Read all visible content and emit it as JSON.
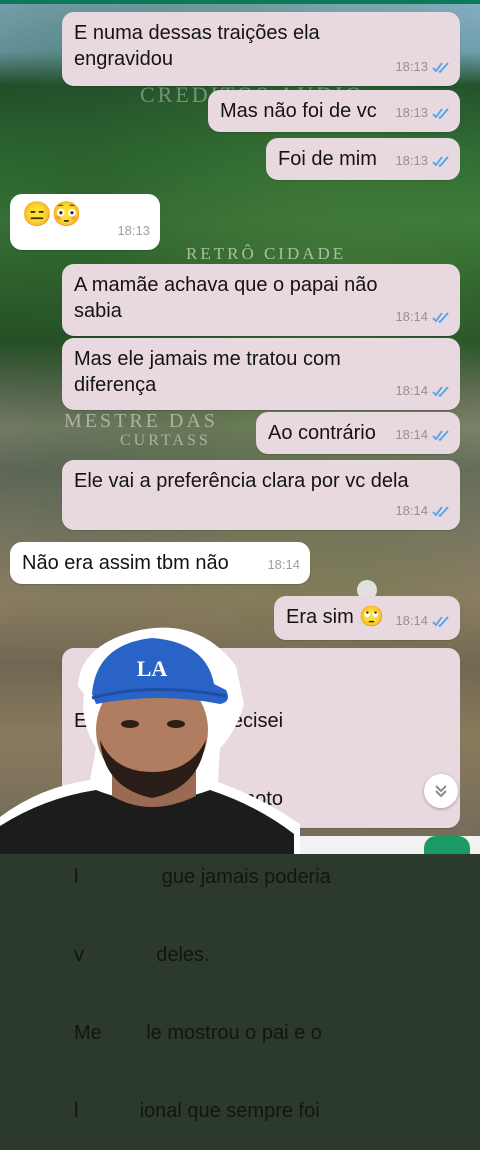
{
  "watermarks": [
    "CREDITOS AUDIO",
    "RETRÔ CIDADE",
    "MESTRE DAS",
    "CURTASS"
  ],
  "messages": [
    {
      "dir": "out",
      "text": "E numa dessas traições ela engravidou",
      "time": "18:13",
      "status": "read"
    },
    {
      "dir": "out",
      "text": "Mas não foi de vc",
      "time": "18:13",
      "status": "read"
    },
    {
      "dir": "out",
      "text": "Foi de mim",
      "time": "18:13",
      "status": "read"
    },
    {
      "dir": "in",
      "text": "😑😳",
      "time": "18:13"
    },
    {
      "dir": "out",
      "text": "A mamãe achava que o papai não sabia",
      "time": "18:14",
      "status": "read"
    },
    {
      "dir": "out",
      "text": "Mas ele jamais me tratou com diferença",
      "time": "18:14",
      "status": "read"
    },
    {
      "dir": "out",
      "text": "Ao contrário",
      "time": "18:14",
      "status": "read"
    },
    {
      "dir": "out",
      "text": "Ele vai a preferência clara por vc dela",
      "time": "18:14",
      "status": "read"
    },
    {
      "dir": "in",
      "text": "Não era assim tbm não",
      "time": "18:14"
    },
    {
      "dir": "out",
      "text": "Era sim 🙄",
      "time": "18:14",
      "status": "read"
    },
    {
      "dir": "out",
      "lines": [
        "El      uando eu precisei",
        "d              o cai de moto",
        "l               gue jamais poderia",
        "v             deles.",
        "Me        le mostrou o pai e o",
        "l           ional que sempre foi"
      ]
    }
  ],
  "overlay": {
    "cap_logo": "LA"
  },
  "colors": {
    "outgoing": "#e8d8df",
    "incoming": "#ffffff",
    "tick": "#4fa3e8"
  },
  "icons": {
    "scroll_down": "chevron-double-down-icon"
  }
}
